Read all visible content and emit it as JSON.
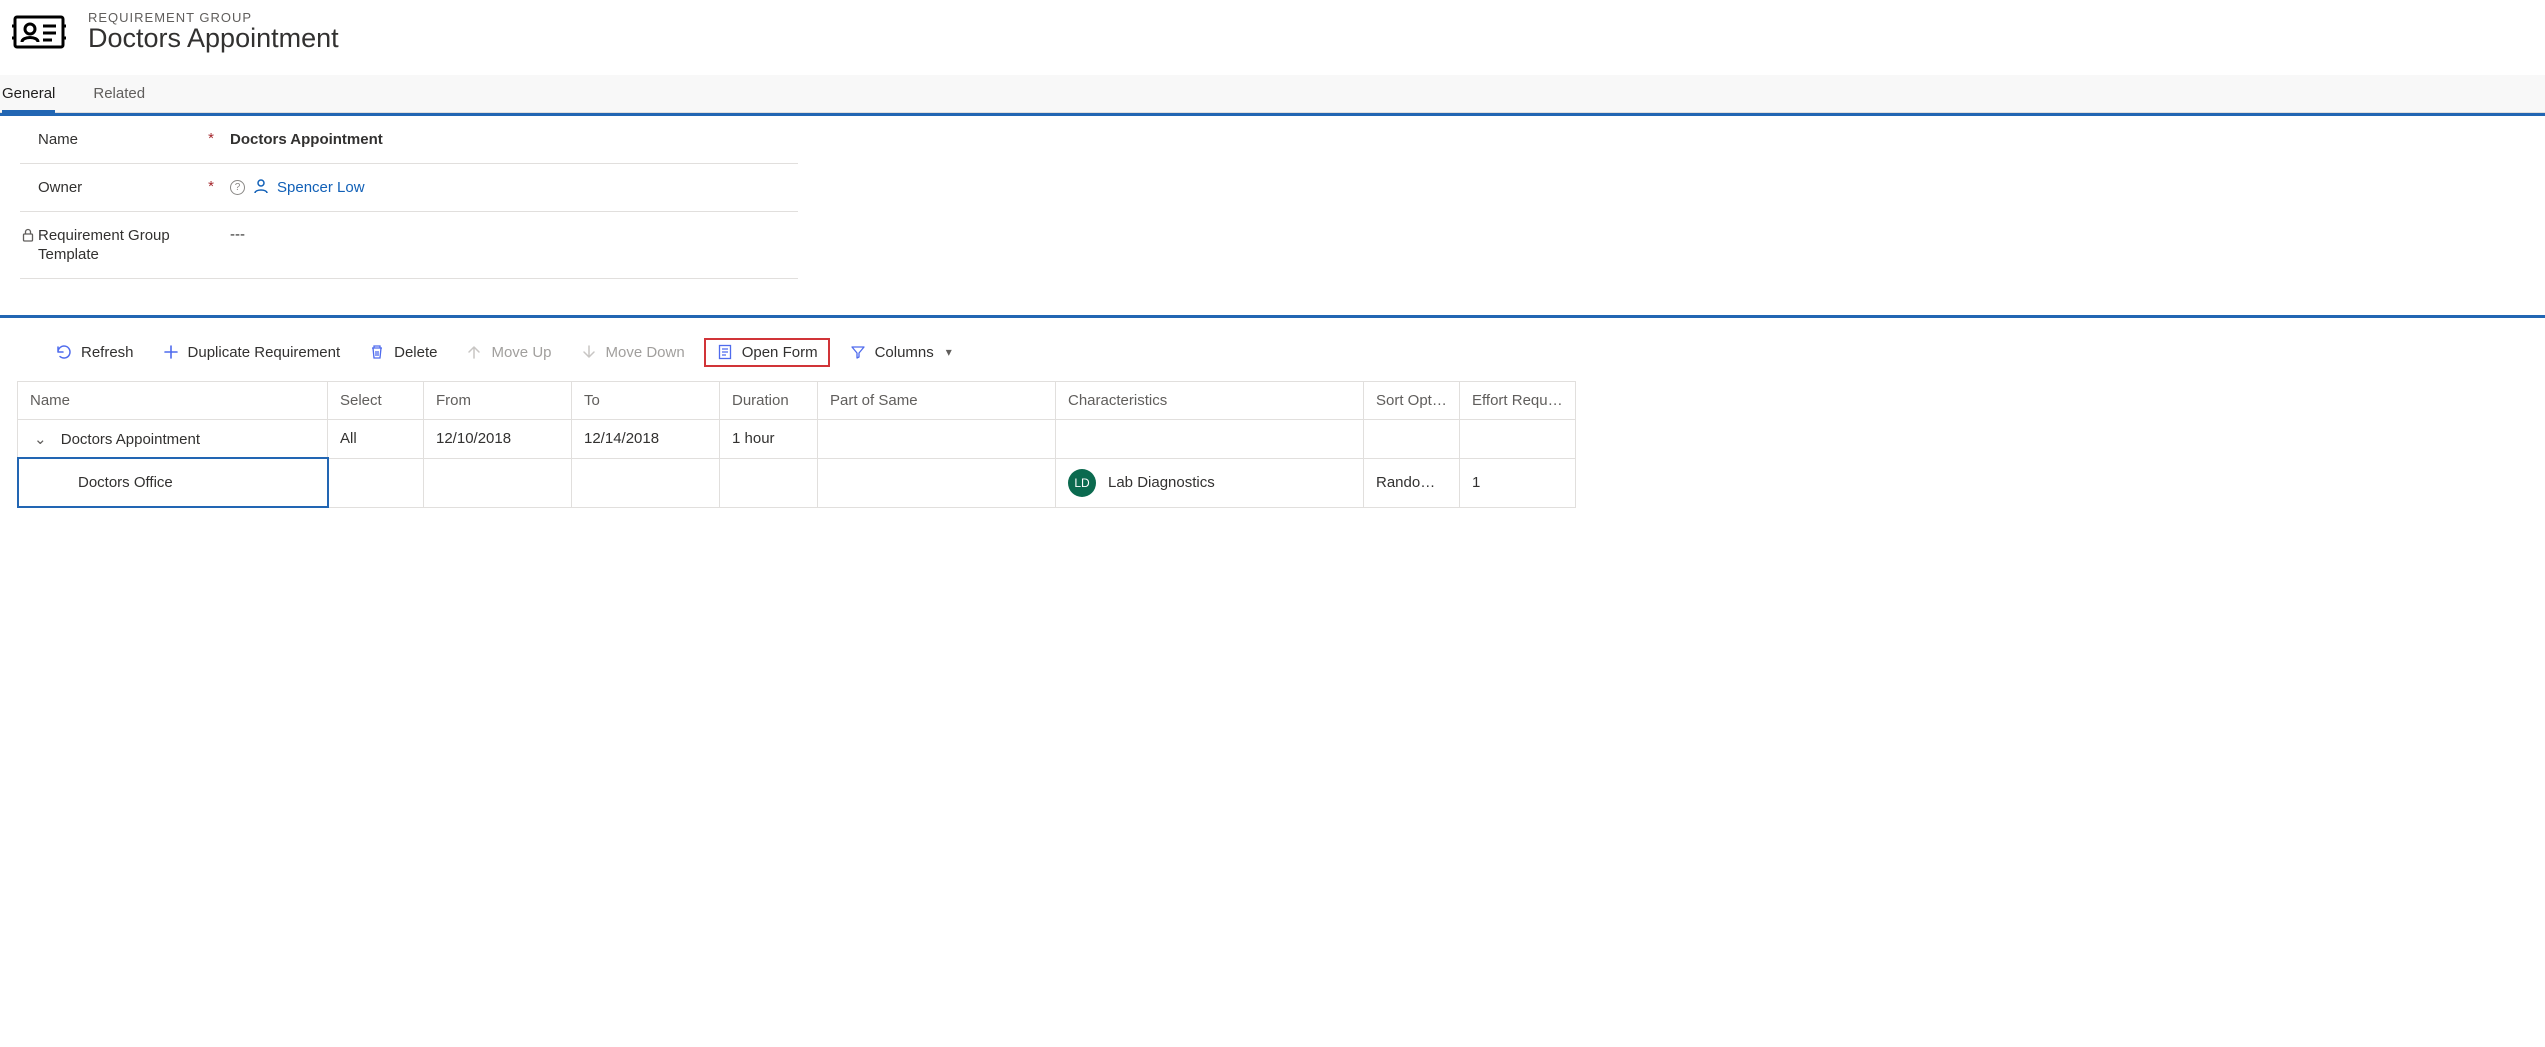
{
  "header": {
    "eyebrow": "REQUIREMENT GROUP",
    "title": "Doctors Appointment"
  },
  "tabs": {
    "general": "General",
    "related": "Related"
  },
  "fields": {
    "name_label": "Name",
    "name_value": "Doctors Appointment",
    "owner_label": "Owner",
    "owner_value": "Spencer Low",
    "template_label": "Requirement Group Template",
    "template_value": "---"
  },
  "toolbar": {
    "refresh": "Refresh",
    "duplicate": "Duplicate Requirement",
    "delete": "Delete",
    "move_up": "Move Up",
    "move_down": "Move Down",
    "open_form": "Open Form",
    "columns": "Columns"
  },
  "grid": {
    "headers": {
      "name": "Name",
      "select": "Select",
      "from": "From",
      "to": "To",
      "duration": "Duration",
      "part_of_same": "Part of Same",
      "characteristics": "Characteristics",
      "sort_option": "Sort Option",
      "effort_required": "Effort Require"
    },
    "rows": [
      {
        "name": "Doctors Appointment",
        "select": "All",
        "from": "12/10/2018",
        "to": "12/14/2018",
        "duration": "1 hour",
        "part_of_same": "",
        "characteristics": "",
        "char_badge": "",
        "sort_option": "",
        "effort_required": ""
      },
      {
        "name": "Doctors Office",
        "select": "",
        "from": "",
        "to": "",
        "duration": "",
        "part_of_same": "",
        "characteristics": "Lab Diagnostics",
        "char_badge": "LD",
        "sort_option": "Randomize",
        "effort_required": "1"
      }
    ]
  }
}
